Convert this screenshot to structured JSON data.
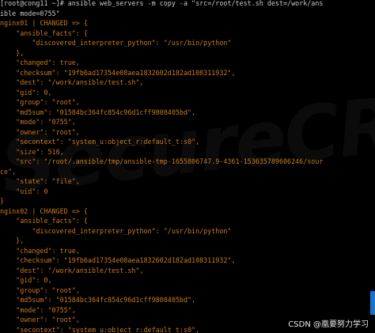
{
  "terminal": {
    "lines": [
      {
        "text": "[root@cong11 ~]# ansible web_servers -m copy -a \"src=/root/test.sh dest=/work/ans",
        "color": "#c8c8c8"
      },
      {
        "text": "ible mode=0755\"",
        "color": "#c8c8c8"
      },
      {
        "text": "nginx01 | CHANGED => {",
        "color": "#c87a1e"
      },
      {
        "text": "    \"ansible_facts\": {",
        "color": "#c87a1e"
      },
      {
        "text": "        \"discovered_interpreter_python\": \"/usr/bin/python\"",
        "color": "#c87a1e"
      },
      {
        "text": "    },",
        "color": "#c87a1e"
      },
      {
        "text": "    \"changed\": true,",
        "color": "#c87a1e"
      },
      {
        "text": "    \"checksum\": \"19fb6ad17354e08aea1832602d182ad108311932\",",
        "color": "#c87a1e"
      },
      {
        "text": "    \"dest\": \"/work/ansible/test.sh\",",
        "color": "#c87a1e"
      },
      {
        "text": "    \"gid\": 0,",
        "color": "#c87a1e"
      },
      {
        "text": "    \"group\": \"root\",",
        "color": "#c87a1e"
      },
      {
        "text": "    \"md5sum\": \"01584bc364fc854c96d1cff9808405bd\",",
        "color": "#c87a1e"
      },
      {
        "text": "    \"mode\": \"0755\",",
        "color": "#c87a1e"
      },
      {
        "text": "    \"owner\": \"root\",",
        "color": "#c87a1e"
      },
      {
        "text": "    \"secontext\": \"system_u:object_r:default_t:s0\",",
        "color": "#c87a1e"
      },
      {
        "text": "    \"size\": 516,",
        "color": "#c87a1e"
      },
      {
        "text": "    \"src\": \"/root/.ansible/tmp/ansible-tmp-1655806747.9-4361-153635789606246/sour",
        "color": "#c87a1e"
      },
      {
        "text": "ce\",",
        "color": "#c87a1e"
      },
      {
        "text": "    \"state\": \"file\",",
        "color": "#c87a1e"
      },
      {
        "text": "    \"uid\": 0",
        "color": "#c87a1e"
      },
      {
        "text": "}",
        "color": "#c87a1e"
      },
      {
        "text": "nginx02 | CHANGED => {",
        "color": "#c87a1e"
      },
      {
        "text": "    \"ansible_facts\": {",
        "color": "#c87a1e"
      },
      {
        "text": "        \"discovered_interpreter_python\": \"/usr/bin/python\"",
        "color": "#c87a1e"
      },
      {
        "text": "    },",
        "color": "#c87a1e"
      },
      {
        "text": "    \"changed\": true,",
        "color": "#c87a1e"
      },
      {
        "text": "    \"checksum\": \"19fb6ad17354e08aea1832602d182ad108311932\",",
        "color": "#c87a1e"
      },
      {
        "text": "    \"dest\": \"/work/ansible/test.sh\",",
        "color": "#c87a1e"
      },
      {
        "text": "    \"gid\": 0,",
        "color": "#c87a1e"
      },
      {
        "text": "    \"group\": \"root\",",
        "color": "#c87a1e"
      },
      {
        "text": "    \"md5sum\": \"01584bc364fc854c96d1cff9808405bd\",",
        "color": "#c87a1e"
      },
      {
        "text": "    \"mode\": \"0755\",",
        "color": "#c87a1e"
      },
      {
        "text": "    \"owner\": \"root\",",
        "color": "#c87a1e"
      },
      {
        "text": "    \"secontext\": \"system_u:object_r:default_t:s0\",",
        "color": "#c87a1e"
      }
    ]
  },
  "watermark": {
    "text": "SecureCRT"
  },
  "badge": {
    "text": "CSDN @凰要努力学习"
  },
  "colors": {
    "background": "#000000",
    "command": "#c8c8c8",
    "output_changed": "#c87a1e",
    "scrollbar": "#1a73c8"
  }
}
